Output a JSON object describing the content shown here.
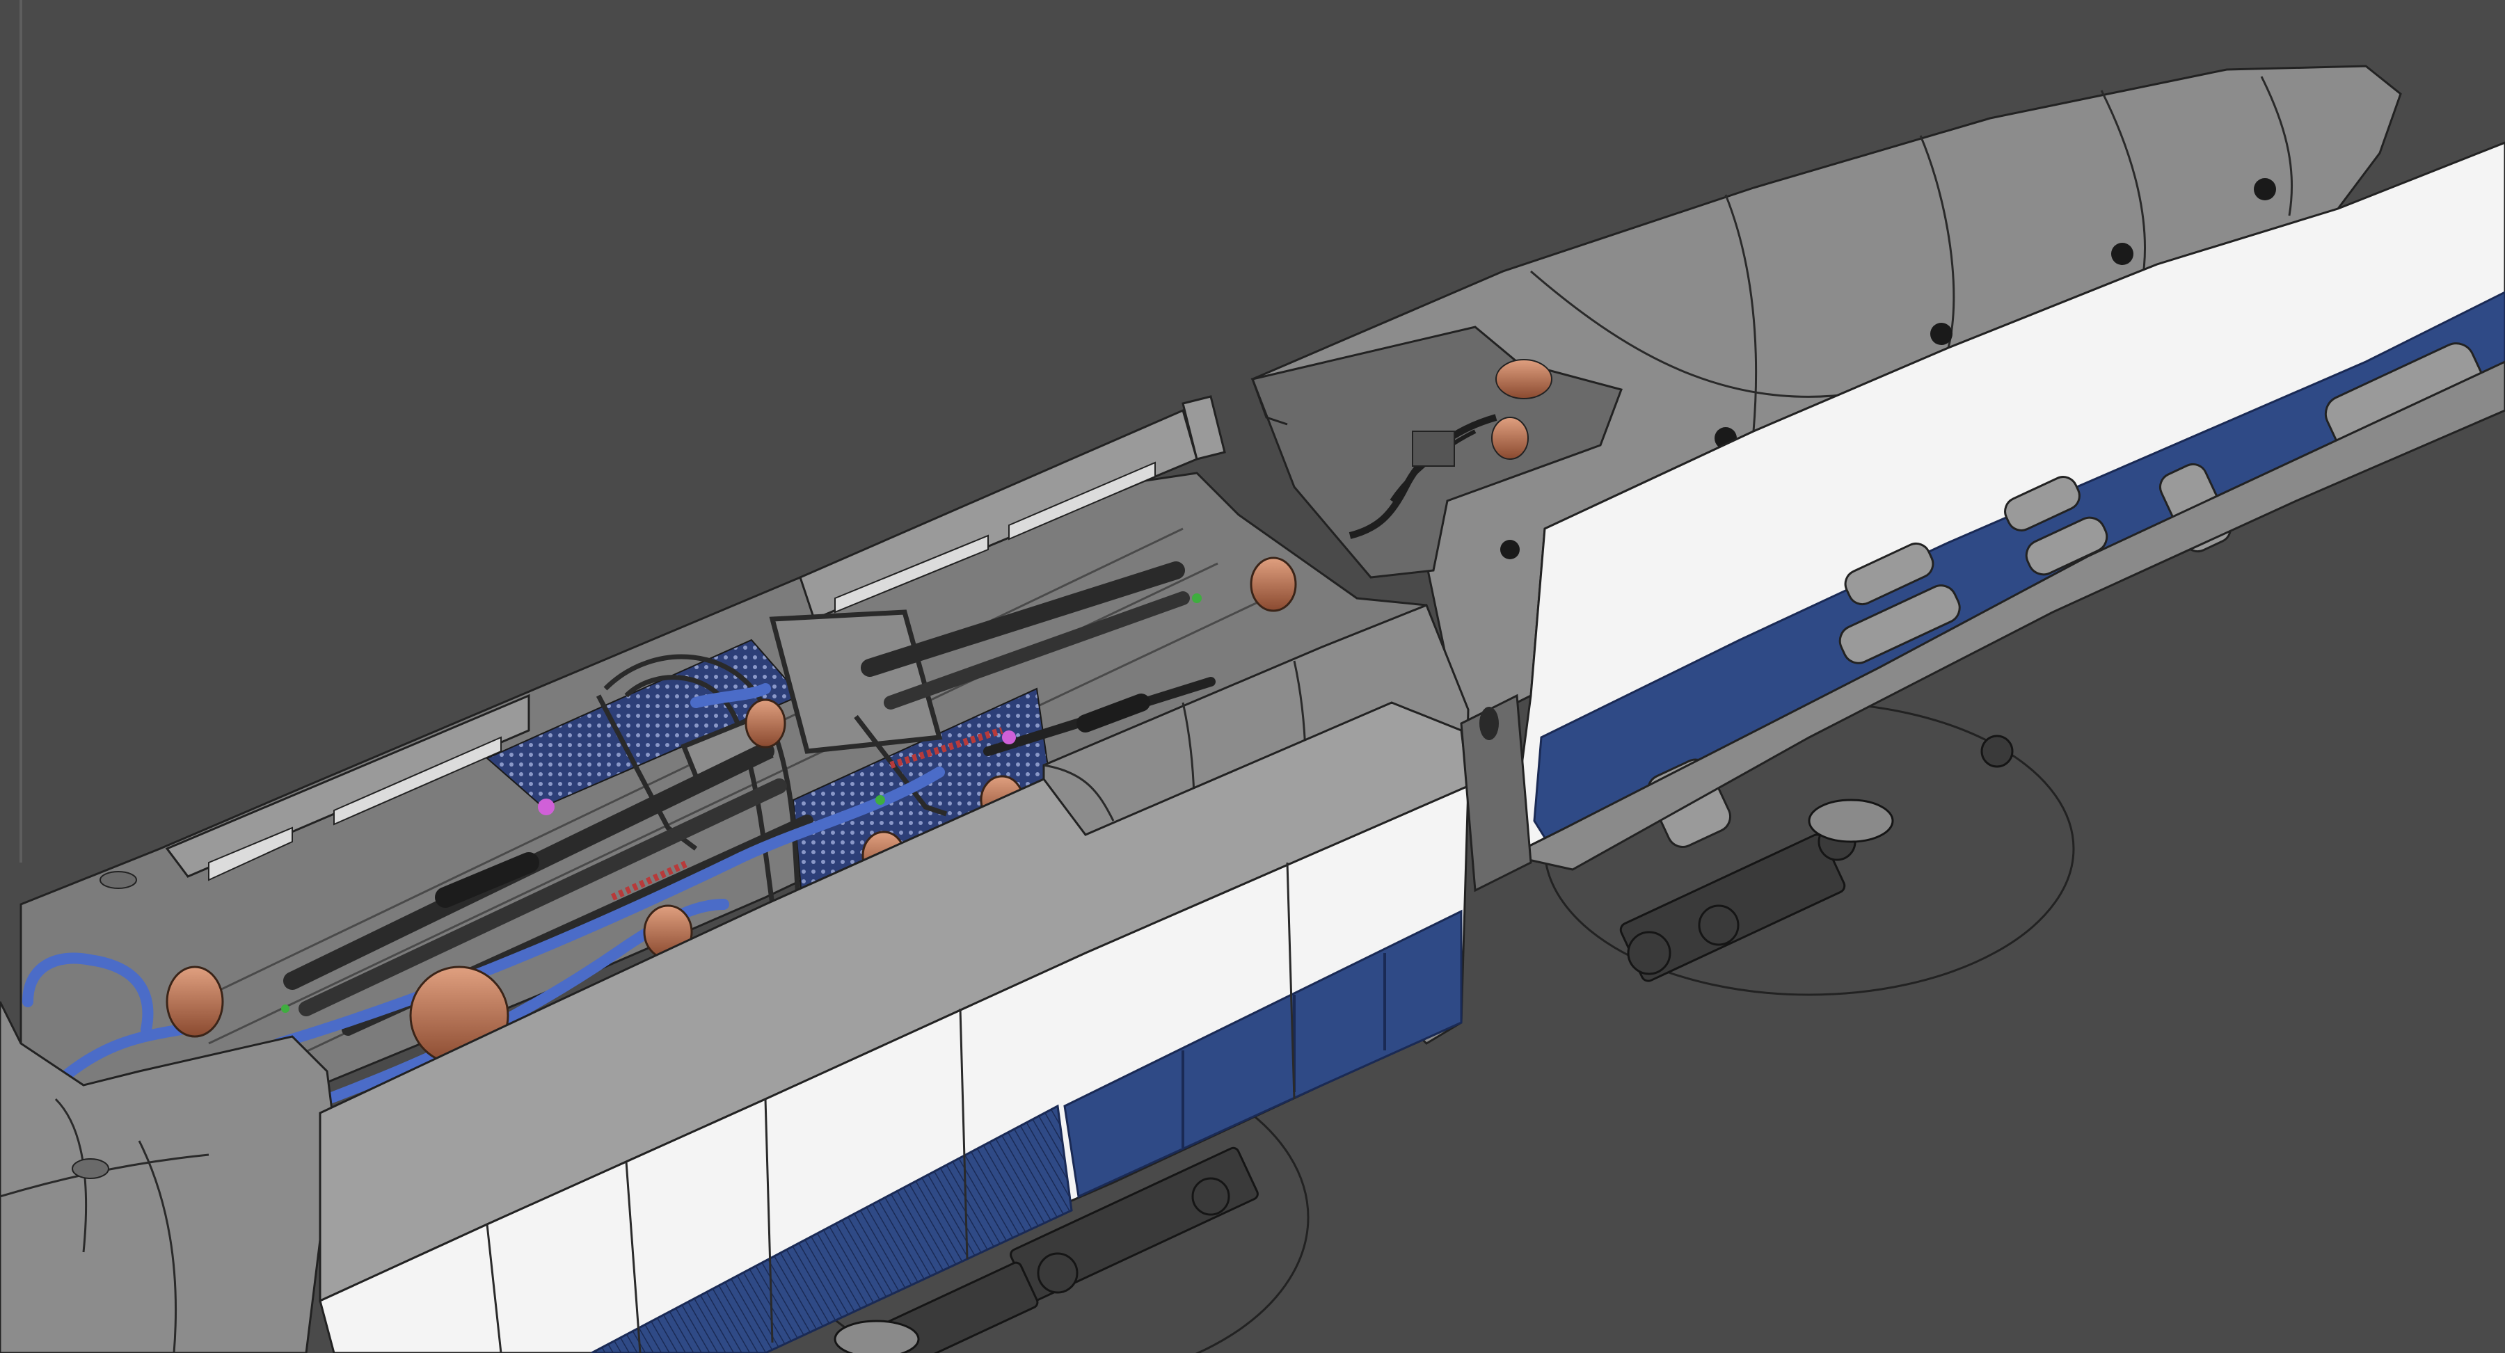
{
  "viewport": {
    "background": "#4a4a4a",
    "render_mode": "shaded-wireframe"
  },
  "scene": {
    "subject": "high-speed-train-power-car-roof",
    "colors": {
      "body_grey": "#8c8c8c",
      "body_grey_light": "#a6a6a6",
      "body_grey_dark": "#6a6a6a",
      "white_band": "#f4f4f4",
      "blue_band": "#2f4a86",
      "blue_dark": "#1f3366",
      "window_grey": "#9a9a9a",
      "copper": "#b8704a",
      "roof_floor": "#7c7c7c",
      "mesh_blue": "#2d3f78",
      "pipe_blue": "#4b6cc8",
      "magenta": "#d060d8",
      "green": "#3fae3f",
      "wire": "#1e1e1e"
    }
  }
}
